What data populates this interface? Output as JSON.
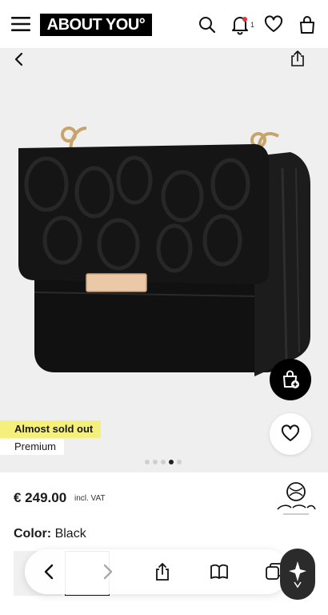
{
  "header": {
    "logo_text": "ABOUT YOU°",
    "notification_count": "1",
    "icons": [
      "menu-icon",
      "search-icon",
      "bell-icon",
      "heart-icon",
      "bag-icon"
    ]
  },
  "gallery": {
    "icons": [
      "back-icon",
      "share-icon"
    ],
    "badges": {
      "sold": "Almost sold out",
      "premium": "Premium"
    },
    "dots_total": 5,
    "active_dot": 4
  },
  "product": {
    "price": "€ 249.00",
    "vat": "incl. VAT",
    "color_label": "Color:",
    "color_value": "Black",
    "brand": "Carlo Colucci"
  },
  "browser": {
    "icons": [
      "back-icon",
      "forward-icon",
      "share-icon",
      "book-icon",
      "tabs-icon"
    ]
  },
  "colors": {
    "badge_yellow": "#f5ef7e",
    "gallery_bg": "#efefef"
  }
}
